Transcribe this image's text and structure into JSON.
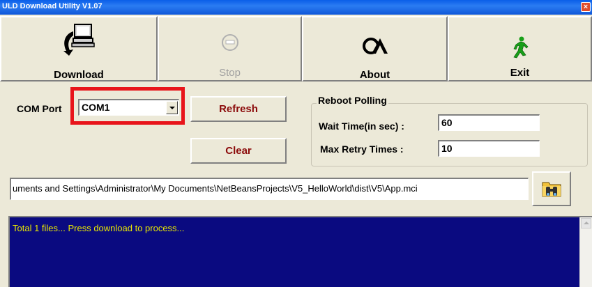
{
  "window": {
    "title": "ULD Download Utility  V1.07",
    "close_label": "×"
  },
  "toolbar": {
    "download_label": "Download",
    "stop_label": "Stop",
    "about_label": "About",
    "exit_label": "Exit"
  },
  "com": {
    "label": "COM Port",
    "value": "COM1"
  },
  "buttons": {
    "refresh_label": "Refresh",
    "clear_label": "Clear"
  },
  "reboot": {
    "title": "Reboot Polling",
    "wait_label": "Wait Time(in sec) :",
    "wait_value": "60",
    "retry_label": "Max Retry Times :",
    "retry_value": "10"
  },
  "path": {
    "value": "uments and Settings\\Administrator\\My Documents\\NetBeansProjects\\V5_HelloWorld\\dist\\V5\\App.mci"
  },
  "console": {
    "text": "Total 1 files... Press download to process..."
  },
  "icons": {
    "download": "computer-download-icon",
    "stop": "stop-icon",
    "about": "about-logo-icon",
    "exit": "running-man-icon",
    "browse": "binoculars-folder-icon"
  },
  "colors": {
    "title_bar": "#0a5ee8",
    "console_bg": "#0a0a80",
    "console_text": "#e8e800",
    "highlight": "#e8141a",
    "button_text": "#8b0a0a"
  }
}
